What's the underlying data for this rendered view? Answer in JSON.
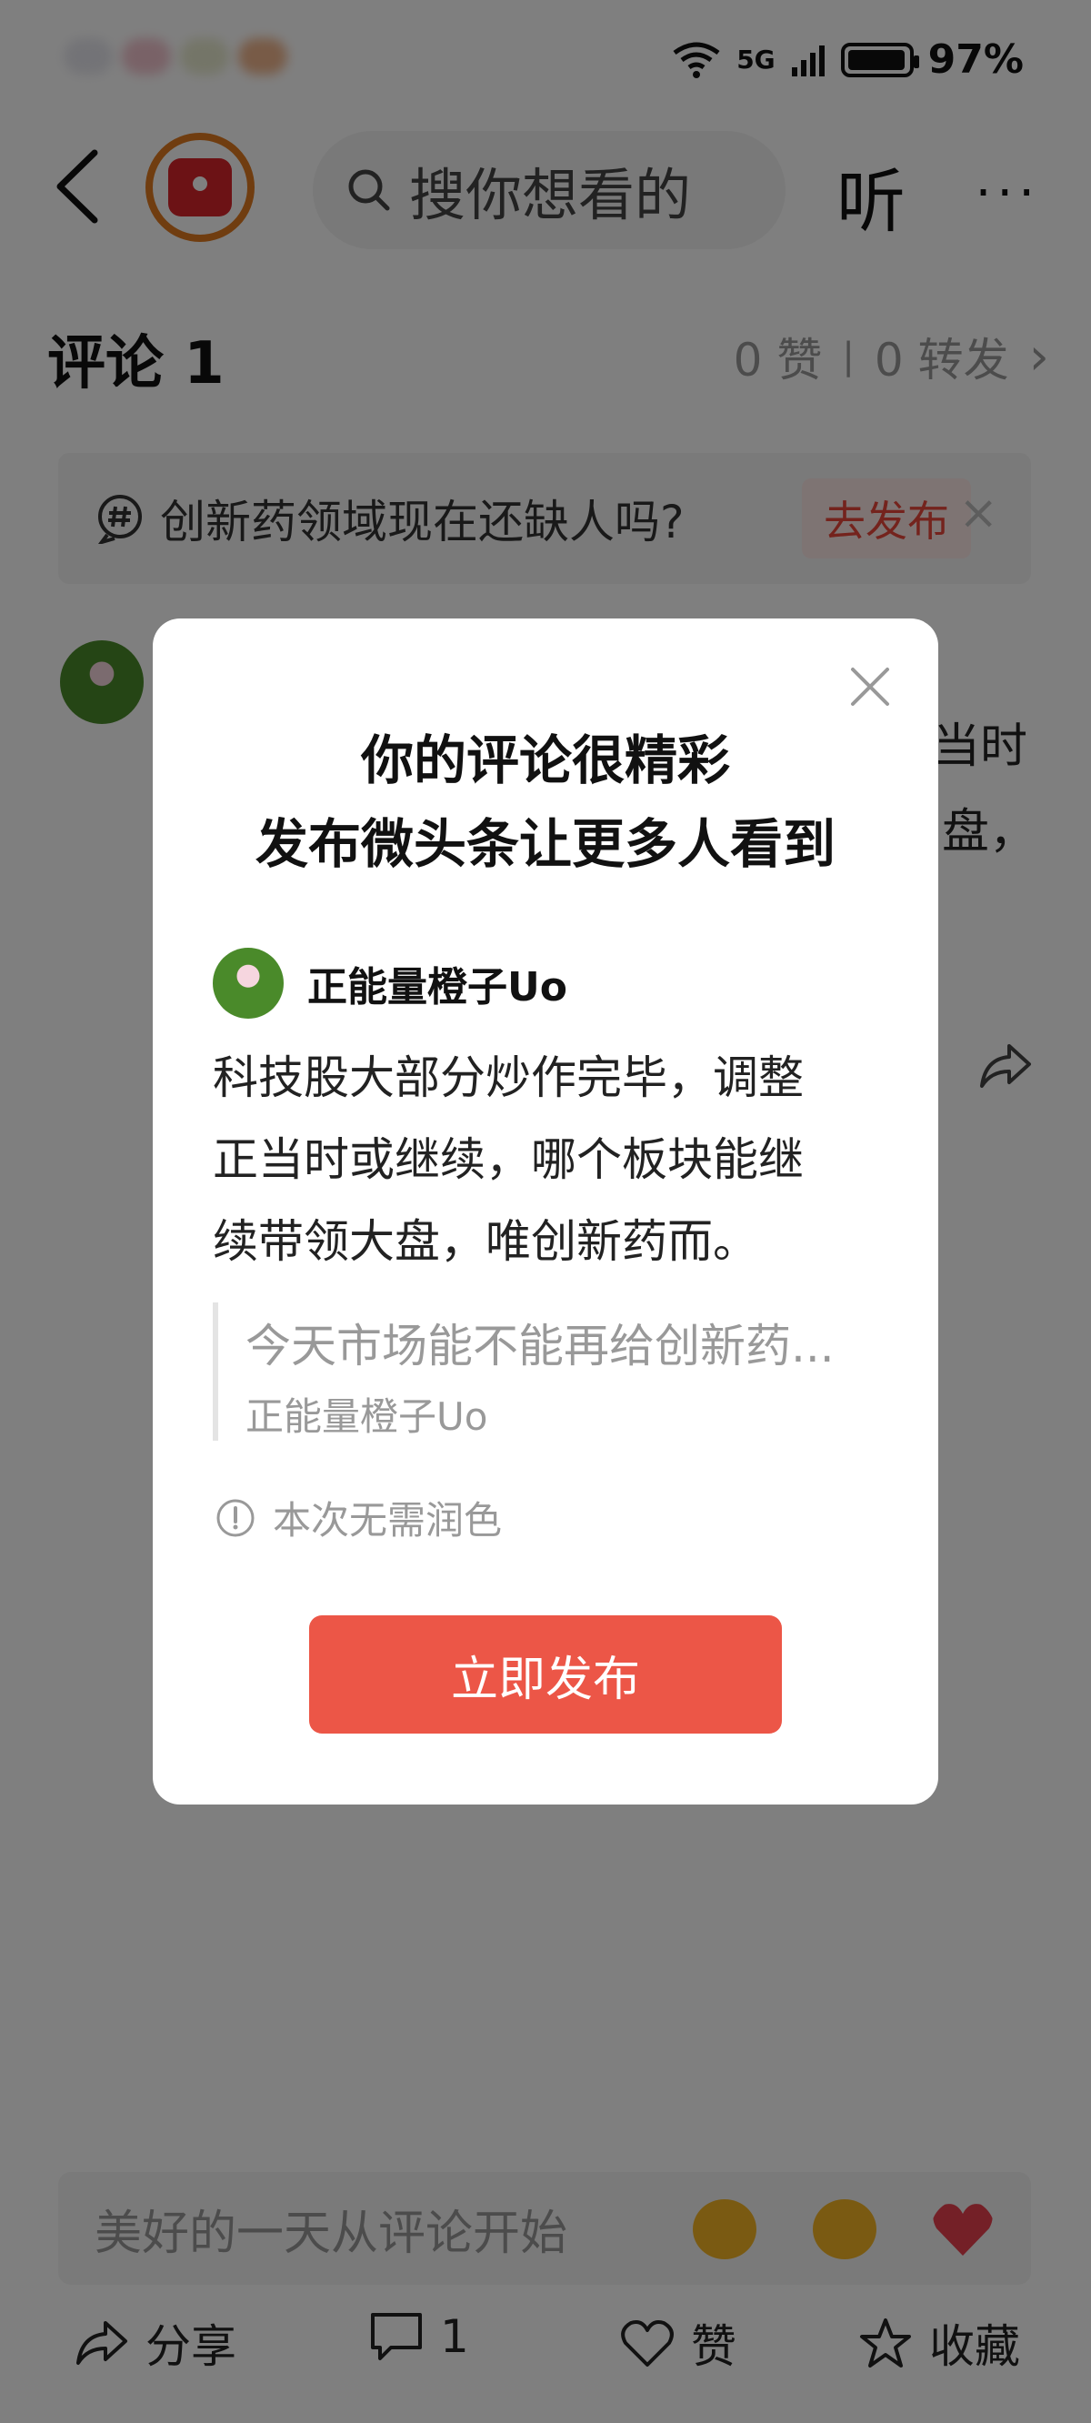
{
  "status_bar": {
    "network": "5G",
    "battery": "97%",
    "battery_level": 0.97
  },
  "header": {
    "search_placeholder": "搜你想看的",
    "listen_label": "听",
    "more_label": "···"
  },
  "comments": {
    "title": "评论 1",
    "likes": "0 赞",
    "separator": "|",
    "reposts": "0 转发",
    "chevron": "›"
  },
  "topic": {
    "text": "创新药领域现在还缺人吗?",
    "button": "去发布",
    "close": "×"
  },
  "background_comment": {
    "line1_tail": "当时",
    "line2_tail": "盘，"
  },
  "modal": {
    "title_line1": "你的评论很精彩",
    "title_line2": "发布微头条让更多人看到",
    "author": "正能量橙子Uo",
    "body_line1": "科技股大部分炒作完毕，调整",
    "body_line2": "正当时或继续，哪个板块能继",
    "body_line3": "续带领大盘，唯创新药而。",
    "quote_title": "今天市场能不能再给创新药...",
    "quote_author": "正能量橙子Uo",
    "note": "本次无需润色",
    "publish_button": "立即发布"
  },
  "bottom": {
    "comment_placeholder": "美好的一天从评论开始",
    "share_label": "分享",
    "comment_count": "1",
    "like_label": "赞",
    "favorite_label": "收藏"
  },
  "colors": {
    "accent_red": "#ec5647",
    "logo_orange": "#e07a20",
    "overlay": "rgba(0,0,0,0.5)"
  },
  "icons": [
    "back-arrow-icon",
    "app-logo-icon",
    "search-icon",
    "hashtag-icon",
    "close-icon",
    "share-icon",
    "comment-icon",
    "heart-icon",
    "star-icon",
    "info-icon",
    "laugh-emoji-icon",
    "grin-emoji-icon",
    "heart-emoji-icon"
  ]
}
